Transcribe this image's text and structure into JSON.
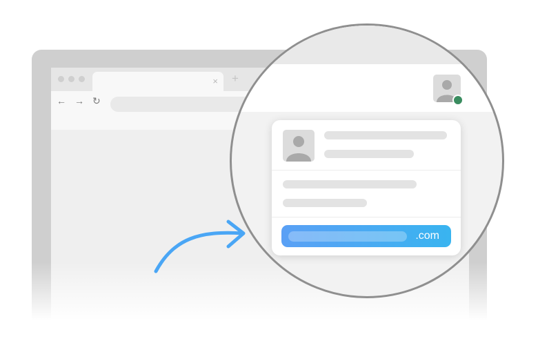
{
  "browser": {
    "tab_close": "×",
    "new_tab": "+",
    "nav_back": "←",
    "nav_forward": "→",
    "nav_reload": "↻"
  },
  "profile_popup": {
    "email_suffix": ".com",
    "button_color": "#39b4f0",
    "status_color": "#3a8c5f"
  },
  "icons": [
    "back-arrow-icon",
    "forward-arrow-icon",
    "reload-icon",
    "close-icon",
    "plus-icon",
    "avatar-icon",
    "curved-arrow-icon"
  ]
}
